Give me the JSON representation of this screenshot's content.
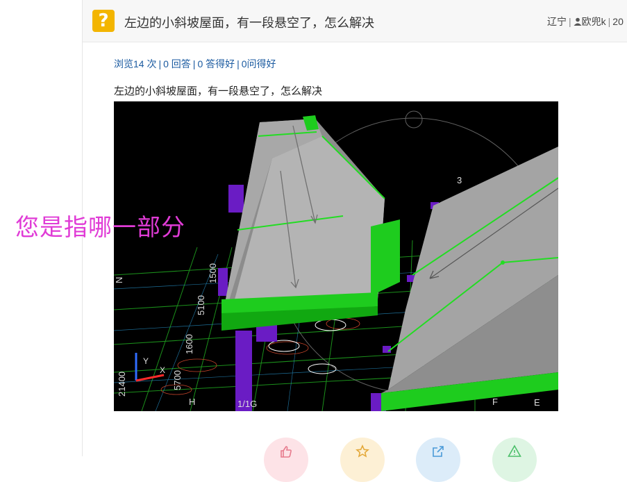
{
  "question": {
    "icon": "question-mark-icon",
    "title": "左边的小斜坡屋面，有一段悬空了，怎么解决",
    "meta": {
      "region": "辽宁",
      "user_icon": "user-icon",
      "username": "欧兜k",
      "date_fragment": "20"
    }
  },
  "stats": {
    "views": "浏览14 次",
    "answers": "0 回答",
    "good_answers": "0 答得好",
    "asked_good": "0问得好"
  },
  "content": {
    "text": "左边的小斜坡屋面，有一段悬空了，怎么解决",
    "annotation": "您是指哪一部分",
    "cad_labels": [
      "1500",
      "5100",
      "1600",
      "5700",
      "21400",
      "1/1G",
      "H",
      "F",
      "E",
      "3",
      "N",
      "Y",
      "X"
    ]
  },
  "actions": [
    {
      "name": "like-button",
      "icon": "thumbs-up-icon",
      "color": "#fde3e7",
      "stroke": "#e77a8c"
    },
    {
      "name": "favorite-button",
      "icon": "star-icon",
      "color": "#fdf0d5",
      "stroke": "#e4a93a"
    },
    {
      "name": "share-button",
      "icon": "share-icon",
      "color": "#dcecf9",
      "stroke": "#4a9ad8"
    },
    {
      "name": "report-button",
      "icon": "warning-icon",
      "color": "#def5e3",
      "stroke": "#4cbf6a"
    }
  ],
  "colors": {
    "accent_link": "#1a5aa0",
    "question_icon": "#f3b500",
    "annotation": "#e03bd6"
  }
}
